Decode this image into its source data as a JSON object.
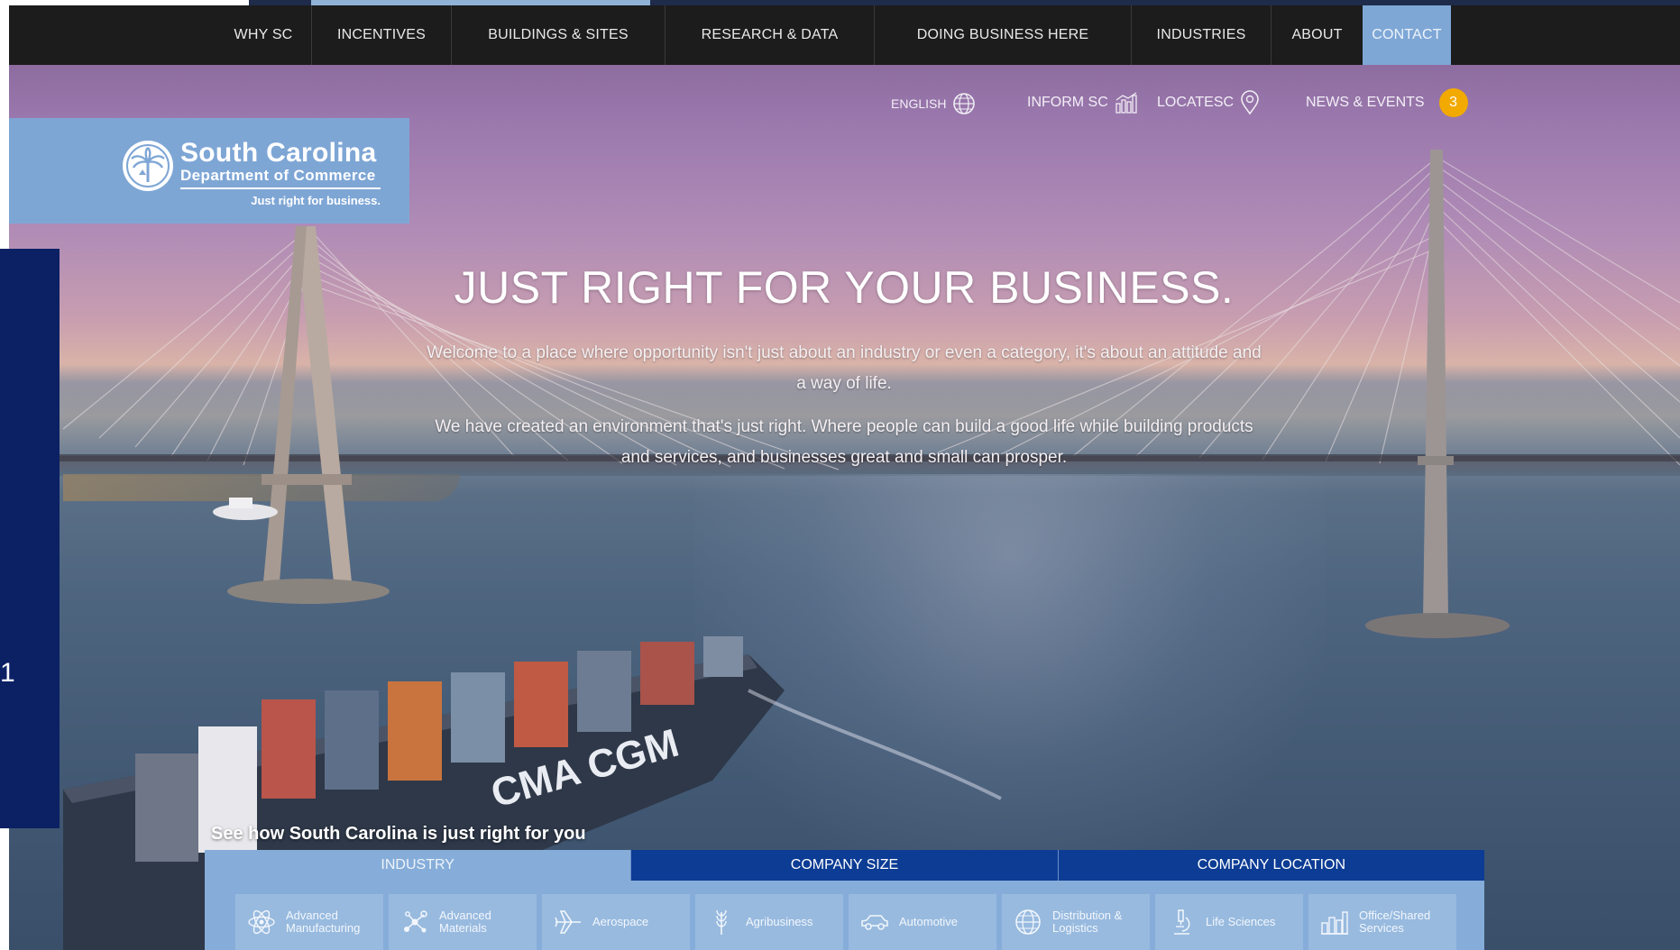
{
  "nav": {
    "items": [
      {
        "label": "WHY SC"
      },
      {
        "label": "INCENTIVES"
      },
      {
        "label": "BUILDINGS & SITES"
      },
      {
        "label": "RESEARCH & DATA"
      },
      {
        "label": "DOING BUSINESS HERE"
      },
      {
        "label": "INDUSTRIES"
      },
      {
        "label": "ABOUT"
      },
      {
        "label": "CONTACT"
      }
    ],
    "active": "CONTACT"
  },
  "utility": {
    "language": "ENGLISH",
    "inform": "INFORM SC",
    "locate": "LOCATESC",
    "news": "NEWS & EVENTS",
    "news_count": "3"
  },
  "logo": {
    "title": "South Carolina",
    "subtitle": "Department of Commerce",
    "tagline": "Just right for business."
  },
  "side_panel": {
    "number": "1"
  },
  "hero": {
    "title": "JUST RIGHT FOR YOUR BUSINESS.",
    "p1": "Welcome to a place where opportunity isn't just about an industry or even a category, it's about an attitude and a way of life.",
    "p2": "We have created an environment that's just right. Where people can build a good life while building products and services, and businesses great and small can prosper."
  },
  "ship": {
    "hull_text": "CMA CGM"
  },
  "explore": {
    "heading": "See how South Carolina is just right for you",
    "tabs": [
      {
        "label": "INDUSTRY"
      },
      {
        "label": "COMPANY SIZE"
      },
      {
        "label": "COMPANY LOCATION"
      }
    ],
    "active_tab": "INDUSTRY",
    "industries": [
      {
        "line1": "Advanced",
        "line2": "Manufacturing",
        "icon": "atom-icon"
      },
      {
        "line1": "Advanced",
        "line2": "Materials",
        "icon": "molecule-icon"
      },
      {
        "line1": "Aerospace",
        "line2": "",
        "icon": "airplane-icon"
      },
      {
        "line1": "Agribusiness",
        "line2": "",
        "icon": "wheat-icon"
      },
      {
        "line1": "Automotive",
        "line2": "",
        "icon": "car-icon"
      },
      {
        "line1": "Distribution &",
        "line2": "Logistics",
        "icon": "globe-icon"
      },
      {
        "line1": "Life Sciences",
        "line2": "",
        "icon": "microscope-icon"
      },
      {
        "line1": "Office/Shared",
        "line2": "Services",
        "icon": "office-icon"
      }
    ]
  },
  "colors": {
    "nav_bg": "#1c1c1c",
    "accent_light_blue": "#7ea6d5",
    "navy": "#0b2164",
    "tab_blue": "#0c3c94",
    "badge_orange": "#f2a900"
  }
}
